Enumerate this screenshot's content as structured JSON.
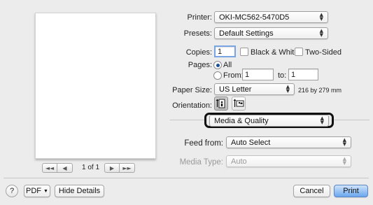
{
  "preview": {
    "first_icon": "first-page-icon",
    "prev_icon": "previous-page-icon",
    "next_icon": "next-page-icon",
    "last_icon": "last-page-icon",
    "page_indicator": "1 of 1"
  },
  "printer": {
    "label": "Printer:",
    "value": "OKI-MC562-5470D5"
  },
  "presets": {
    "label": "Presets:",
    "value": "Default Settings"
  },
  "copies": {
    "label": "Copies:",
    "value": "1",
    "black_white_label": "Black & White",
    "black_white_checked": false,
    "two_sided_label": "Two-Sided",
    "two_sided_checked": false
  },
  "pages": {
    "label": "Pages:",
    "all_label": "All",
    "all_selected": true,
    "from_label": "From:",
    "from_value": "1",
    "to_label": "to:",
    "to_value": "1"
  },
  "paper_size": {
    "label": "Paper Size:",
    "value": "US Letter",
    "dimensions": "216 by 279 mm"
  },
  "orientation": {
    "label": "Orientation:",
    "selected": "portrait",
    "portrait_icon": "portrait-orientation-icon",
    "landscape_icon": "landscape-orientation-icon"
  },
  "section": {
    "value": "Media & Quality",
    "highlight_color": "#111111"
  },
  "feed_from": {
    "label": "Feed from:",
    "value": "Auto Select"
  },
  "media_type": {
    "label": "Media Type:",
    "value": "Auto",
    "enabled": false
  },
  "footer": {
    "help_icon": "help-icon",
    "help_label": "?",
    "pdf_label": "PDF",
    "hide_details_label": "Hide Details",
    "cancel_label": "Cancel",
    "print_label": "Print"
  },
  "colors": {
    "default_button": "#6aa7ee",
    "radio_dot": "#1b4f9c"
  }
}
